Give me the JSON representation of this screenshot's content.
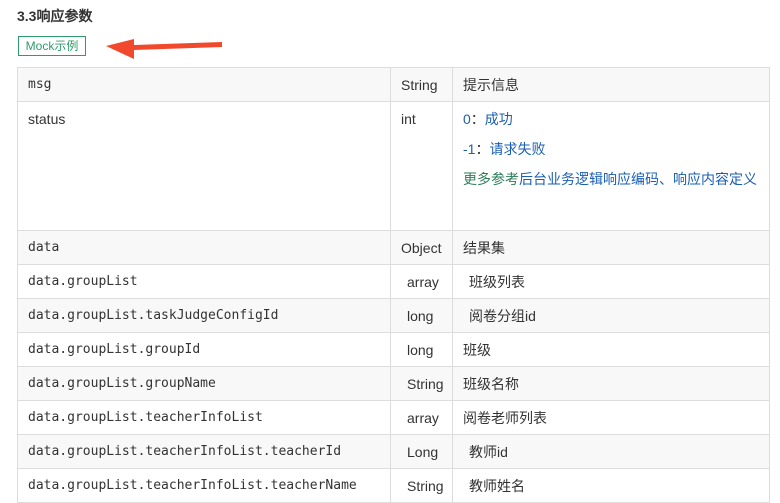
{
  "section": {
    "title": "3.3响应参数"
  },
  "mock_button": {
    "label": "Mock示例"
  },
  "colors": {
    "accent_green": "#2e9c6a",
    "arrow_red": "#f0492b",
    "border": "#dddddd",
    "link_blue": "#1a5fb4"
  },
  "table": {
    "rows": [
      {
        "name": "msg",
        "type": "String",
        "desc": "提示信息"
      },
      {
        "name": "status",
        "type": "int",
        "desc_lines": {
          "ok_code": "0",
          "ok_sep": "：",
          "ok_text": "成功",
          "fail_code": "-1",
          "fail_sep": "：",
          "fail_text": "请求失败",
          "note_prefix": "更多参考",
          "note_link": "后台业务逻辑响应编码、响应内容定义"
        }
      },
      {
        "name": "data",
        "type": "Object",
        "desc": "结果集"
      },
      {
        "name": "data.groupList",
        "type": "array",
        "desc": "班级列表"
      },
      {
        "name": "data.groupList.taskJudgeConfigId",
        "type": "long",
        "desc": "阅卷分组id"
      },
      {
        "name": "data.groupList.groupId",
        "type": "long",
        "desc": "班级"
      },
      {
        "name": "data.groupList.groupName",
        "type": "String",
        "desc": "班级名称"
      },
      {
        "name": "data.groupList.teacherInfoList",
        "type": "array",
        "desc": "阅卷老师列表"
      },
      {
        "name": "data.groupList.teacherInfoList.teacherId",
        "type": "Long",
        "desc": "教师id"
      },
      {
        "name": "data.groupList.teacherInfoList.teacherName",
        "type": "String",
        "desc": "教师姓名"
      }
    ]
  }
}
